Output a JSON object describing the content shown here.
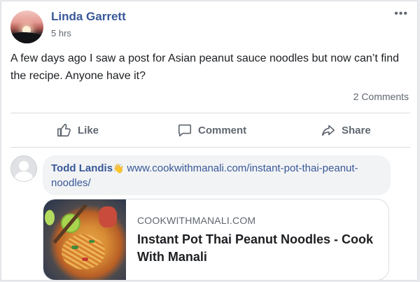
{
  "post": {
    "author": "Linda Garrett",
    "time": "5 hrs",
    "more_label": "•••",
    "text": "A few days ago I saw a post for Asian peanut sauce noodles but now can’t find the recipe. Anyone have it?",
    "comments_count": "2 Comments"
  },
  "actions": {
    "like": "Like",
    "comment": "Comment",
    "share": "Share"
  },
  "comment": {
    "author": "Todd Landis",
    "wave_glyph": "👋",
    "link_text": "www.cookwithmanali.com/instant-pot-thai-peanut-noodles/"
  },
  "preview": {
    "domain": "COOKWITHMANALI.COM",
    "title": "Instant Pot Thai Peanut Noodles - Cook With Manali"
  },
  "icons": {
    "avatar": "avatar-photo",
    "like": "thumbs-up-icon",
    "comment": "speech-bubble-icon",
    "share": "share-arrow-icon",
    "wave": "wave-icon"
  },
  "colors": {
    "link_blue": "#385898",
    "meta_gray": "#606770",
    "background": "#e9ebee"
  }
}
